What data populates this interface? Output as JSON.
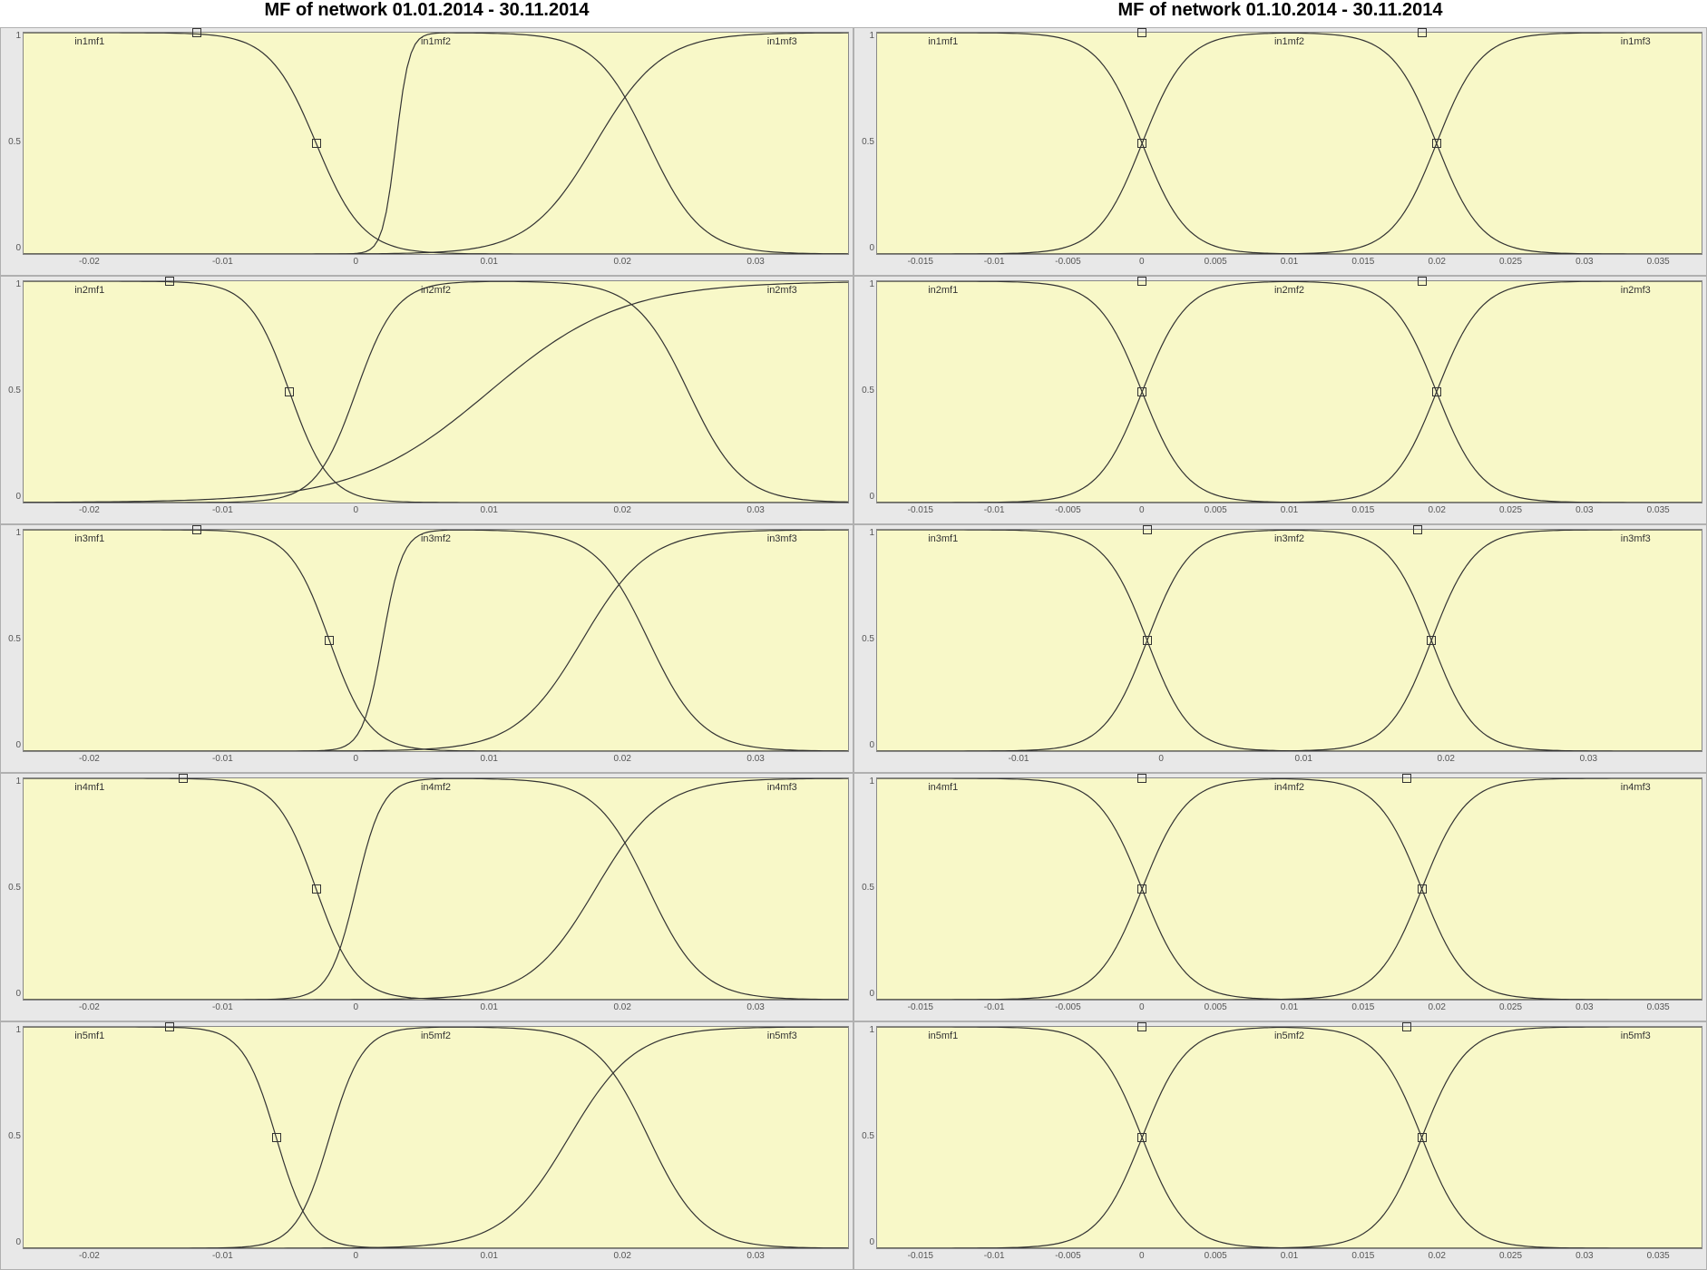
{
  "titles": {
    "left": "MF of network 01.01.2014 - 30.11.2014",
    "right": "MF of network 01.10.2014 - 30.11.2014"
  },
  "y_ticks": [
    "1",
    "0.5",
    "0"
  ],
  "chart_data": [
    {
      "column": "left",
      "title": "MF of network 01.01.2014 - 30.11.2014",
      "x_range": [
        -0.025,
        0.037
      ],
      "y_range": [
        0,
        1
      ],
      "x_ticks": [
        -0.02,
        -0.01,
        0,
        0.01,
        0.02,
        0.03
      ],
      "panels": [
        {
          "input": 1,
          "mf_labels": [
            "in1mf1",
            "in1mf2",
            "in1mf3"
          ],
          "type": "membership-functions-sigmoid",
          "curves": [
            {
              "name": "in1mf1",
              "type": "sigmoid-fall",
              "center": -0.003,
              "width": 0.007,
              "markers": [
                {
                  "x": -0.012,
                  "y": 1.0
                },
                {
                  "x": -0.003,
                  "y": 0.5
                }
              ]
            },
            {
              "name": "in1mf2",
              "type": "bell",
              "rise_center": 0.003,
              "rise_width": 0.002,
              "fall_center": 0.022,
              "fall_width": 0.008
            },
            {
              "name": "in1mf3",
              "type": "sigmoid-rise",
              "center": 0.018,
              "width": 0.01
            }
          ]
        },
        {
          "input": 2,
          "mf_labels": [
            "in2mf1",
            "in2mf2",
            "in2mf3"
          ],
          "type": "membership-functions-sigmoid",
          "curves": [
            {
              "name": "in2mf1",
              "type": "sigmoid-fall",
              "center": -0.005,
              "width": 0.006,
              "markers": [
                {
                  "x": -0.014,
                  "y": 1.0
                },
                {
                  "x": -0.005,
                  "y": 0.5
                }
              ]
            },
            {
              "name": "in2mf2",
              "type": "bell",
              "rise_center": 0.0,
              "rise_width": 0.006,
              "fall_center": 0.025,
              "fall_width": 0.008
            },
            {
              "name": "in2mf3",
              "type": "sigmoid-rise",
              "center": 0.01,
              "width": 0.02
            }
          ]
        },
        {
          "input": 3,
          "mf_labels": [
            "in3mf1",
            "in3mf2",
            "in3mf3"
          ],
          "type": "membership-functions-sigmoid",
          "curves": [
            {
              "name": "in3mf1",
              "type": "sigmoid-fall",
              "center": -0.002,
              "width": 0.006,
              "markers": [
                {
                  "x": -0.012,
                  "y": 1.0
                },
                {
                  "x": -0.002,
                  "y": 0.5
                }
              ]
            },
            {
              "name": "in3mf2",
              "type": "bell",
              "rise_center": 0.002,
              "rise_width": 0.003,
              "fall_center": 0.022,
              "fall_width": 0.008
            },
            {
              "name": "in3mf3",
              "type": "sigmoid-rise",
              "center": 0.017,
              "width": 0.01
            }
          ]
        },
        {
          "input": 4,
          "mf_labels": [
            "in4mf1",
            "in4mf2",
            "in4mf3"
          ],
          "type": "membership-functions-sigmoid",
          "curves": [
            {
              "name": "in4mf1",
              "type": "sigmoid-fall",
              "center": -0.003,
              "width": 0.006,
              "markers": [
                {
                  "x": -0.013,
                  "y": 1.0
                },
                {
                  "x": -0.003,
                  "y": 0.5
                }
              ]
            },
            {
              "name": "in4mf2",
              "type": "bell",
              "rise_center": 0.0,
              "rise_width": 0.004,
              "fall_center": 0.022,
              "fall_width": 0.008
            },
            {
              "name": "in4mf3",
              "type": "sigmoid-rise",
              "center": 0.018,
              "width": 0.01
            }
          ]
        },
        {
          "input": 5,
          "mf_labels": [
            "in5mf1",
            "in5mf2",
            "in5mf3"
          ],
          "type": "membership-functions-sigmoid",
          "curves": [
            {
              "name": "in5mf1",
              "type": "sigmoid-fall",
              "center": -0.006,
              "width": 0.005,
              "markers": [
                {
                  "x": -0.014,
                  "y": 1.0
                },
                {
                  "x": -0.006,
                  "y": 0.5
                }
              ]
            },
            {
              "name": "in5mf2",
              "type": "bell",
              "rise_center": -0.002,
              "rise_width": 0.005,
              "fall_center": 0.022,
              "fall_width": 0.008
            },
            {
              "name": "in5mf3",
              "type": "sigmoid-rise",
              "center": 0.016,
              "width": 0.01
            }
          ]
        }
      ]
    },
    {
      "column": "right",
      "title": "MF of network 01.10.2014 - 30.11.2014",
      "x_range": [
        -0.018,
        0.038
      ],
      "y_range": [
        0,
        1
      ],
      "x_ticks_std": [
        -0.015,
        -0.01,
        -0.005,
        0,
        0.005,
        0.01,
        0.015,
        0.02,
        0.025,
        0.03,
        0.035
      ],
      "x_ticks_alt": [
        -0.01,
        0,
        0.01,
        0.02,
        0.03
      ],
      "panels": [
        {
          "input": 1,
          "mf_labels": [
            "in1mf1",
            "in1mf2",
            "in1mf3"
          ],
          "type": "membership-functions-sigmoid",
          "x_ticks_key": "std",
          "curves": [
            {
              "name": "in1mf1",
              "type": "sigmoid-fall",
              "center": 0.0,
              "width": 0.006
            },
            {
              "name": "in1mf2",
              "type": "bell",
              "rise_center": 0.0,
              "rise_width": 0.006,
              "fall_center": 0.02,
              "fall_width": 0.006,
              "markers": [
                {
                  "x": 0.0,
                  "y": 1.0
                },
                {
                  "x": 0.019,
                  "y": 1.0
                }
              ]
            },
            {
              "name": "in1mf3",
              "type": "sigmoid-rise",
              "center": 0.02,
              "width": 0.006
            }
          ],
          "cross_markers": [
            {
              "x": 0.0,
              "y": 0.5
            },
            {
              "x": 0.02,
              "y": 0.5
            }
          ]
        },
        {
          "input": 2,
          "mf_labels": [
            "in2mf1",
            "in2mf2",
            "in2mf3"
          ],
          "type": "membership-functions-sigmoid",
          "x_ticks_key": "std",
          "curves": [
            {
              "name": "in2mf1",
              "type": "sigmoid-fall",
              "center": 0.0,
              "width": 0.006
            },
            {
              "name": "in2mf2",
              "type": "bell",
              "rise_center": 0.0,
              "rise_width": 0.006,
              "fall_center": 0.02,
              "fall_width": 0.006,
              "markers": [
                {
                  "x": 0.0,
                  "y": 1.0
                },
                {
                  "x": 0.019,
                  "y": 1.0
                }
              ]
            },
            {
              "name": "in2mf3",
              "type": "sigmoid-rise",
              "center": 0.02,
              "width": 0.006
            }
          ],
          "cross_markers": [
            {
              "x": 0.0,
              "y": 0.5
            },
            {
              "x": 0.02,
              "y": 0.5
            }
          ]
        },
        {
          "input": 3,
          "mf_labels": [
            "in3mf1",
            "in3mf2",
            "in3mf3"
          ],
          "type": "membership-functions-sigmoid",
          "x_ticks_key": "alt",
          "x_range_override": [
            -0.02,
            0.038
          ],
          "curves": [
            {
              "name": "in3mf1",
              "type": "sigmoid-fall",
              "center": -0.001,
              "width": 0.006
            },
            {
              "name": "in3mf2",
              "type": "bell",
              "rise_center": -0.001,
              "rise_width": 0.006,
              "fall_center": 0.019,
              "fall_width": 0.006,
              "markers": [
                {
                  "x": -0.001,
                  "y": 1.0
                },
                {
                  "x": 0.018,
                  "y": 1.0
                }
              ]
            },
            {
              "name": "in3mf3",
              "type": "sigmoid-rise",
              "center": 0.019,
              "width": 0.006
            }
          ],
          "cross_markers": [
            {
              "x": -0.001,
              "y": 0.5
            },
            {
              "x": 0.019,
              "y": 0.5
            }
          ]
        },
        {
          "input": 4,
          "mf_labels": [
            "in4mf1",
            "in4mf2",
            "in4mf3"
          ],
          "type": "membership-functions-sigmoid",
          "x_ticks_key": "std",
          "curves": [
            {
              "name": "in4mf1",
              "type": "sigmoid-fall",
              "center": 0.0,
              "width": 0.006
            },
            {
              "name": "in4mf2",
              "type": "bell",
              "rise_center": 0.0,
              "rise_width": 0.006,
              "fall_center": 0.019,
              "fall_width": 0.006,
              "markers": [
                {
                  "x": 0.0,
                  "y": 1.0
                },
                {
                  "x": 0.018,
                  "y": 1.0
                }
              ]
            },
            {
              "name": "in4mf3",
              "type": "sigmoid-rise",
              "center": 0.019,
              "width": 0.006
            }
          ],
          "cross_markers": [
            {
              "x": 0.0,
              "y": 0.5
            },
            {
              "x": 0.019,
              "y": 0.5
            }
          ]
        },
        {
          "input": 5,
          "mf_labels": [
            "in5mf1",
            "in5mf2",
            "in5mf3"
          ],
          "type": "membership-functions-sigmoid",
          "x_ticks_key": "std",
          "curves": [
            {
              "name": "in5mf1",
              "type": "sigmoid-fall",
              "center": 0.0,
              "width": 0.006
            },
            {
              "name": "in5mf2",
              "type": "bell",
              "rise_center": 0.0,
              "rise_width": 0.006,
              "fall_center": 0.019,
              "fall_width": 0.006,
              "markers": [
                {
                  "x": 0.0,
                  "y": 1.0
                },
                {
                  "x": 0.018,
                  "y": 1.0
                }
              ]
            },
            {
              "name": "in5mf3",
              "type": "sigmoid-rise",
              "center": 0.019,
              "width": 0.006
            }
          ],
          "cross_markers": [
            {
              "x": 0.0,
              "y": 0.5
            },
            {
              "x": 0.019,
              "y": 0.5
            }
          ]
        }
      ]
    }
  ]
}
